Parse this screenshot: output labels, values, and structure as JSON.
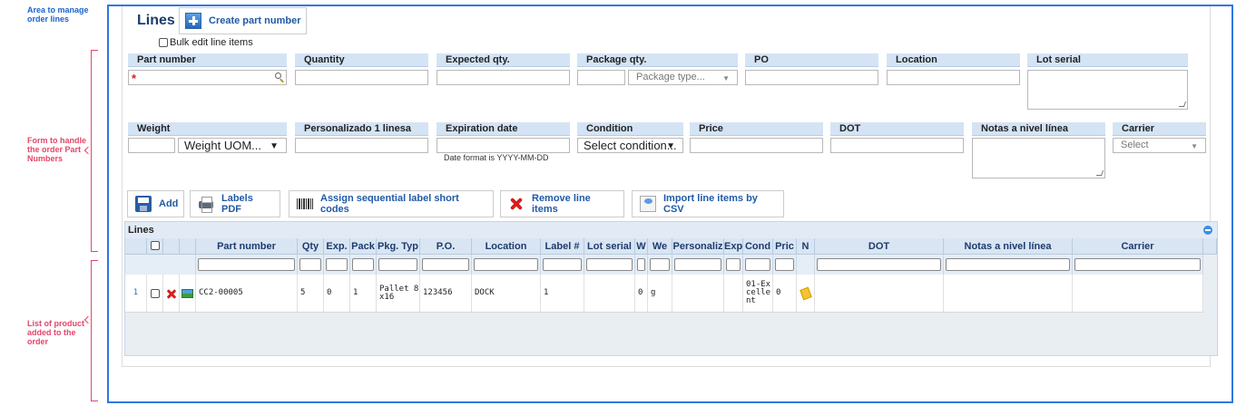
{
  "annotations": {
    "area_order_lines": "Area to manage order lines",
    "form_part_numbers": "Form to handle the order Part Numbers",
    "list_products": "List of product added to the order"
  },
  "header": {
    "title": "Lines",
    "create_button": "Create part number",
    "bulk_edit_label": "Bulk edit line items"
  },
  "form": {
    "row1": {
      "part_number": "Part number",
      "required_mark": "*",
      "quantity": "Quantity",
      "expected_qty": "Expected qty.",
      "package_qty": "Package qty.",
      "package_type_placeholder": "Package type...",
      "po": "PO",
      "location": "Location",
      "lot_serial": "Lot serial"
    },
    "row2": {
      "weight": "Weight",
      "weight_uom": "Weight UOM...",
      "personalizado": "Personalizado 1 linesa",
      "expiration_date": "Expiration date",
      "date_hint": "Date format is YYYY-MM-DD",
      "condition": "Condition",
      "condition_select": "Select condition...",
      "price": "Price",
      "dot": "DOT",
      "notas": "Notas a nivel línea",
      "carrier": "Carrier",
      "carrier_select": "Select"
    }
  },
  "toolbar": {
    "add": "Add",
    "labels_pdf": "Labels PDF",
    "assign_codes": "Assign sequential label short codes",
    "remove_items": "Remove line items",
    "import_csv": "Import line items by CSV"
  },
  "grid": {
    "title": "Lines",
    "columns": [
      "Part number",
      "Qty",
      "Exp.",
      "Pack",
      "Pkg. Typ",
      "P.O.",
      "Location",
      "Label #",
      "Lot serial",
      "W",
      "We",
      "Personaliz",
      "Exp",
      "Cond",
      "Pric",
      "N",
      "DOT",
      "Notas a nivel línea",
      "Carrier"
    ],
    "rows": [
      {
        "row_num": "1",
        "part_number": "CC2-00005",
        "qty": "5",
        "exp": "0",
        "pack": "1",
        "pkg_type": "Pallet 8x16",
        "po": "123456",
        "location": "DOCK",
        "label": "1",
        "lot_serial": "",
        "w": "0",
        "we": "g",
        "personalizado": "",
        "exp_date": "",
        "cond": "01-Excellent",
        "price": "0",
        "dot": "",
        "notas": "",
        "carrier": ""
      }
    ]
  },
  "colors": {
    "frame": "#2f78e0",
    "annotation_blue": "#1a64c8",
    "annotation_red": "#e4456a",
    "header_blue": "#d4e4f5"
  }
}
